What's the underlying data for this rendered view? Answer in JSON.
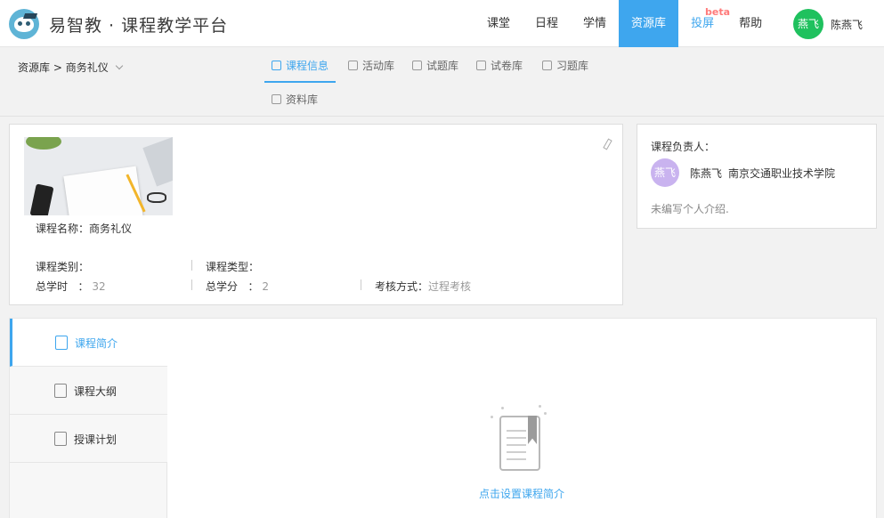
{
  "brand": {
    "title": "易智教 · 课程教学平台",
    "logo": "owl-logo"
  },
  "nav": {
    "items": [
      {
        "label": "课堂"
      },
      {
        "label": "日程"
      },
      {
        "label": "学情"
      },
      {
        "label": "资源库",
        "active": true
      },
      {
        "label": "投屏"
      },
      {
        "label": "帮助"
      }
    ],
    "beta_badge": "beta",
    "user_avatar_text": "燕飞",
    "user_name": "陈燕飞"
  },
  "breadcrumb": {
    "root": "资源库",
    "separator": ">",
    "course": "商务礼仪"
  },
  "tabs": [
    {
      "label": "课程信息",
      "icon": "course-info-icon",
      "active": true
    },
    {
      "label": "活动库",
      "icon": "activity-icon"
    },
    {
      "label": "试题库",
      "icon": "question-bank-icon"
    },
    {
      "label": "试卷库",
      "icon": "exam-paper-icon"
    },
    {
      "label": "习题库",
      "icon": "exercise-icon"
    },
    {
      "label": "资料库",
      "icon": "materials-icon"
    }
  ],
  "course": {
    "name_label": "课程名称：",
    "name": "商务礼仪",
    "category_label": "课程类别：",
    "category": "",
    "type_label": "课程类型：",
    "type": "",
    "hours_label": "总学时",
    "hours_colon": "：",
    "hours": "32",
    "credits_label": "总学分",
    "credits_colon": "：",
    "credits": "2",
    "assessment_label": "考核方式：",
    "assessment": "过程考核"
  },
  "owner": {
    "title": "课程负责人：",
    "avatar_text": "燕飞",
    "name": "陈燕飞",
    "school": "南京交通职业技术学院",
    "intro": "未编写个人介绍."
  },
  "side_menu": [
    {
      "label": "课程简介",
      "icon": "intro-icon",
      "active": true
    },
    {
      "label": "课程大纲",
      "icon": "outline-icon"
    },
    {
      "label": "授课计划",
      "icon": "schedule-icon"
    }
  ],
  "empty_state": {
    "text": "点击设置课程简介",
    "icon": "empty-document-icon"
  },
  "colors": {
    "accent": "#3ea6ee",
    "avatar_green": "#1fc15e",
    "avatar_purple": "#c9b3ef",
    "beta": "#ff7a7a"
  }
}
